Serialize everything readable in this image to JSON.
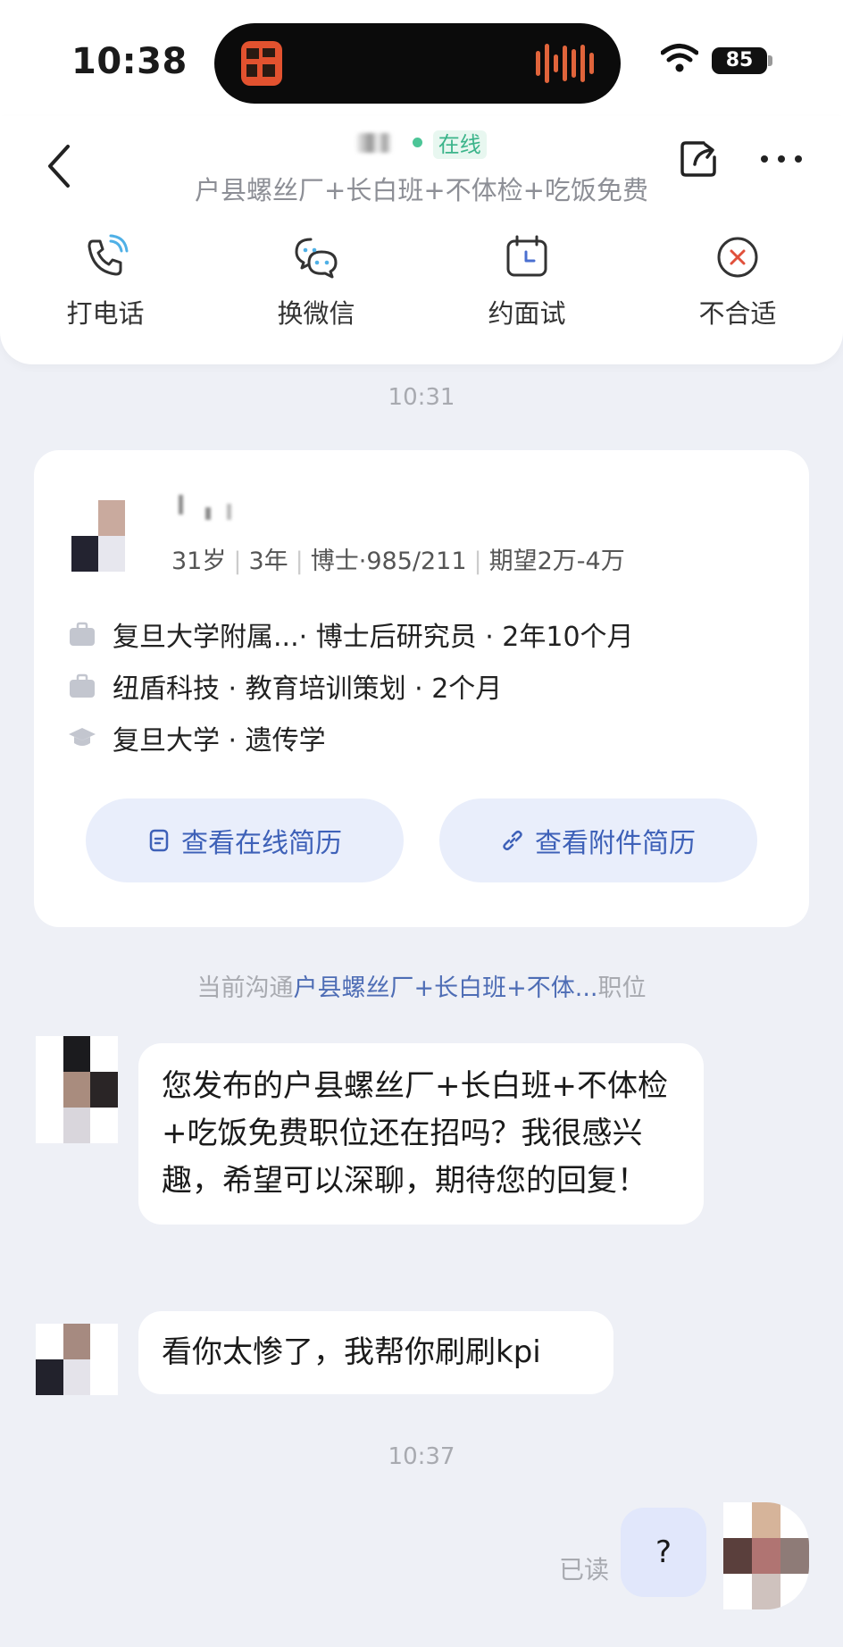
{
  "status_bar": {
    "time": "10:38",
    "battery": "85"
  },
  "header": {
    "online_label": "在线",
    "job_subtitle": "户县螺丝厂+长白班+不体检+吃饭免费",
    "actions": [
      {
        "label": "打电话",
        "icon": "phone-icon"
      },
      {
        "label": "换微信",
        "icon": "wechat-icon"
      },
      {
        "label": "约面试",
        "icon": "calendar-icon"
      },
      {
        "label": "不合适",
        "icon": "reject-icon"
      }
    ]
  },
  "timestamps": {
    "first": "10:31",
    "second": "10:37"
  },
  "resume": {
    "meta": {
      "age": "31岁",
      "experience": "3年",
      "education": "博士·985/211",
      "expectation": "期望2万-4万"
    },
    "history": [
      {
        "text": "复旦大学附属...· 博士后研究员 · 2年10个月",
        "icon": "briefcase-icon"
      },
      {
        "text": "纽盾科技 · 教育培训策划 · 2个月",
        "icon": "briefcase-icon"
      },
      {
        "text": "复旦大学 · 遗传学",
        "icon": "graduation-cap-icon"
      }
    ],
    "online_resume_label": "查看在线简历",
    "attachment_resume_label": "查看附件简历"
  },
  "position_note": {
    "prefix": "当前沟通",
    "position": "户县螺丝厂+长白班+不体...",
    "suffix": "职位"
  },
  "messages": {
    "incoming_1": "您发布的户县螺丝厂+长白班+不体检+吃饭免费职位还在招吗？我很感兴趣，希望可以深聊，期待您的回复！",
    "incoming_2": "看你太惨了，我帮你刷刷kpi",
    "outgoing_1": "?",
    "read_status": "已读"
  },
  "colors": {
    "accent": "#3e61b8",
    "online": "#3bb48a",
    "outgoing_bubble": "#e1e7fb",
    "background": "#eef0f6"
  }
}
